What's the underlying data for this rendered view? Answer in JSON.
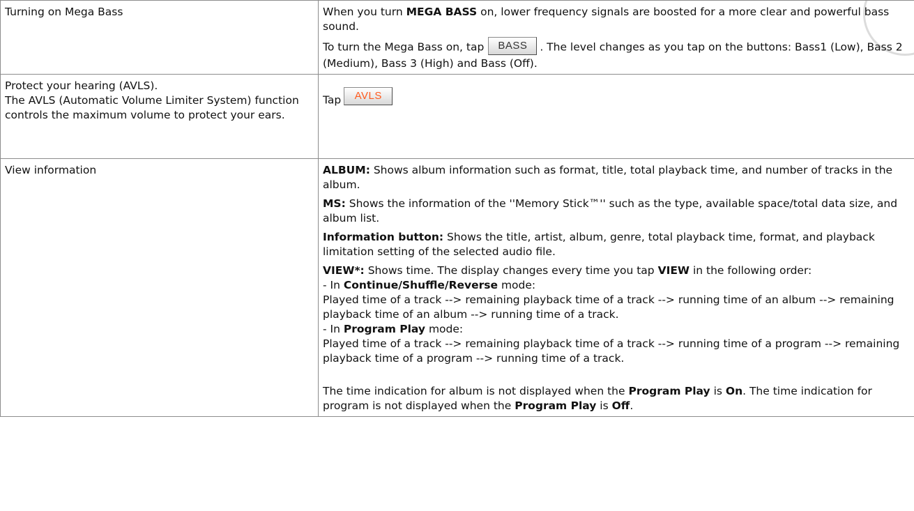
{
  "rows": [
    {
      "feature": "Turning on Mega Bass",
      "desc": {
        "p1_a": "When you turn ",
        "p1_b": "MEGA BASS",
        "p1_c": " on, lower frequency signals are boosted for a more clear and powerful bass sound.",
        "p2_a": "To turn the Mega Bass on, tap",
        "button": "BASS",
        "p2_b": ". The level changes as you tap on the buttons: Bass1 (Low), Bass 2 (Medium), Bass 3 (High) and Bass (Off)."
      }
    },
    {
      "feature_line1": "Protect your hearing (AVLS).",
      "feature_line2": "The AVLS (Automatic Volume Limiter System) function controls the maximum volume to protect your ears.",
      "desc": {
        "tap": "Tap",
        "button": "AVLS"
      }
    },
    {
      "feature": "View information",
      "desc": {
        "album_label": "ALBUM:",
        "album_text": " Shows album information such as format, title, total playback time, and number of tracks in the album.",
        "ms_label": "MS:",
        "ms_text": " Shows the information of the ''Memory Stick™'' such as the type, available space/total data size, and album list.",
        "info_label": "Information button:",
        "info_text": " Shows the title, artist, album, genre, total playback time, format, and playback limitation setting of the selected audio file.",
        "view_label": "VIEW*:",
        "view_text_a": " Shows time. The display changes every time you tap ",
        "view_bold": "VIEW",
        "view_text_b": " in the following order:",
        "mode1_a": "- In ",
        "mode1_bold": "Continue/Shuffle/Reverse",
        "mode1_b": " mode:",
        "mode1_text": "Played time of a track --> remaining playback time of a track --> running time of an album --> remaining playback time of an album --> running time of a track.",
        "mode2_a": "- In ",
        "mode2_bold": "Program Play",
        "mode2_b": " mode:",
        "mode2_text": "Played time of a track --> remaining playback time of a track --> running time of a program --> remaining playback time of a program --> running time of a track.",
        "note_a": "The time indication for album is not displayed when the ",
        "note_b1": "Program Play",
        "note_c": " is ",
        "note_on": "On",
        "note_d": ". The time indication for program is not displayed when the ",
        "note_b2": "Program Play",
        "note_e": " is ",
        "note_off": "Off",
        "note_f": "."
      }
    }
  ]
}
